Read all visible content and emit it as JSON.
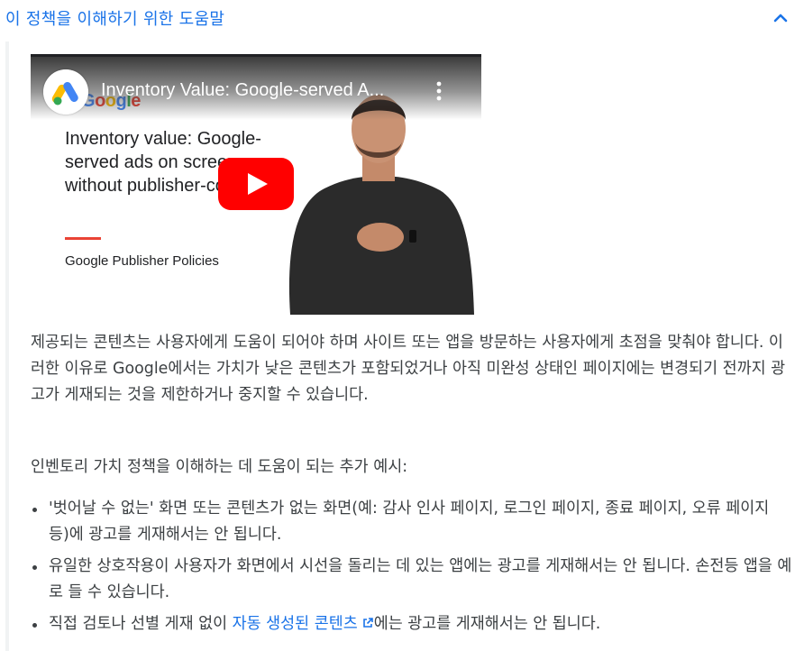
{
  "header": {
    "title": "이 정책을 이해하기 위한 도움말",
    "collapse_icon": "chevron-up-icon"
  },
  "video": {
    "title": "Inventory Value: Google-served A...",
    "channel_logo": "google-ads-logo",
    "menu_icon": "kebab-menu-icon",
    "play_icon": "youtube-play-icon",
    "slide": {
      "brand": "Google",
      "heading": "Inventory value: Google-served ads on screens without publisher-content",
      "footer": "Google Publisher Policies"
    }
  },
  "body": {
    "paragraph1": "제공되는 콘텐츠는 사용자에게 도움이 되어야 하며 사이트 또는 앱을 방문하는 사용자에게 초점을 맞춰야 합니다. 이러한 이유로 Google에서는 가치가 낮은 콘텐츠가 포함되었거나 아직 미완성 상태인 페이지에는 변경되기 전까지 광고가 게재되는 것을 제한하거나 중지할 수 있습니다.",
    "paragraph2": "인벤토리 가치 정책을 이해하는 데 도움이 되는 추가 예시:",
    "bullets": [
      "'벗어날 수 없는' 화면 또는 콘텐츠가 없는 화면(예: 감사 인사 페이지, 로그인 페이지, 종료 페이지, 오류 페이지 등)에 광고를 게재해서는 안 됩니다.",
      "유일한 상호작용이 사용자가 화면에서 시선을 돌리는 데 있는 앱에는 광고를 게재해서는 안 됩니다. 손전등 앱을 예로 들 수 있습니다."
    ],
    "bullet3": {
      "prefix": "직접 검토나 선별 게재 없이 ",
      "link": "자동 생성된 콘텐츠",
      "link_icon": "external-link-icon",
      "suffix": "에는 광고를 게재해서는 안 됩니다."
    }
  },
  "colors": {
    "link": "#1a73e8",
    "text": "#3c4043",
    "youtube_red": "#ff0000"
  }
}
